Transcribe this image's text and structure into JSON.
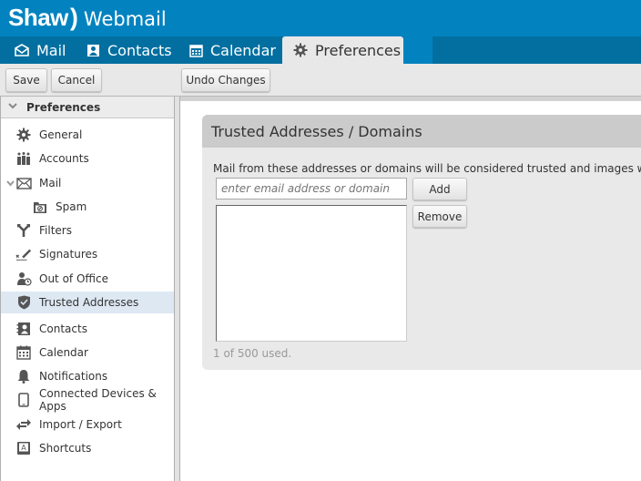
{
  "app": {
    "brand": "Shaw",
    "product": "Webmail"
  },
  "nav": {
    "tabs": [
      {
        "label": "Mail",
        "icon": "envelope-icon"
      },
      {
        "label": "Contacts",
        "icon": "contact-card-icon"
      },
      {
        "label": "Calendar",
        "icon": "calendar-icon"
      },
      {
        "label": "Preferences",
        "icon": "gear-icon",
        "active": true
      }
    ]
  },
  "toolbar": {
    "save_label": "Save",
    "cancel_label": "Cancel",
    "undo_label": "Undo Changes"
  },
  "sidebar": {
    "title": "Preferences",
    "items": [
      {
        "label": "General",
        "icon": "gear-icon"
      },
      {
        "label": "Accounts",
        "icon": "people-icon"
      },
      {
        "label": "Mail",
        "icon": "envelope-icon",
        "expanded": true
      },
      {
        "label": "Spam",
        "icon": "spam-folder-icon",
        "indent": true
      },
      {
        "label": "Filters",
        "icon": "filter-fork-icon"
      },
      {
        "label": "Signatures",
        "icon": "signature-pen-icon"
      },
      {
        "label": "Out of Office",
        "icon": "person-clock-icon"
      },
      {
        "label": "Trusted Addresses",
        "icon": "shield-check-icon",
        "active": true
      },
      {
        "label": "Contacts",
        "icon": "contact-card-icon"
      },
      {
        "label": "Calendar",
        "icon": "calendar-icon"
      },
      {
        "label": "Notifications",
        "icon": "bell-icon"
      },
      {
        "label": "Connected Devices & Apps",
        "icon": "phone-icon"
      },
      {
        "label": "Import / Export",
        "icon": "arrows-exchange-icon"
      },
      {
        "label": "Shortcuts",
        "icon": "keyboard-key-icon"
      }
    ]
  },
  "panel": {
    "title": "Trusted Addresses / Domains",
    "description": "Mail from these addresses or domains will be considered trusted and images will automa",
    "input_placeholder": "enter email address or domain",
    "input_value": "",
    "add_label": "Add",
    "remove_label": "Remove",
    "list_items": [],
    "usage_text": "1 of 500 used."
  },
  "colors": {
    "header": "#0283c0",
    "tab_bar": "#026fa0",
    "active_side": "#dde8f3"
  }
}
